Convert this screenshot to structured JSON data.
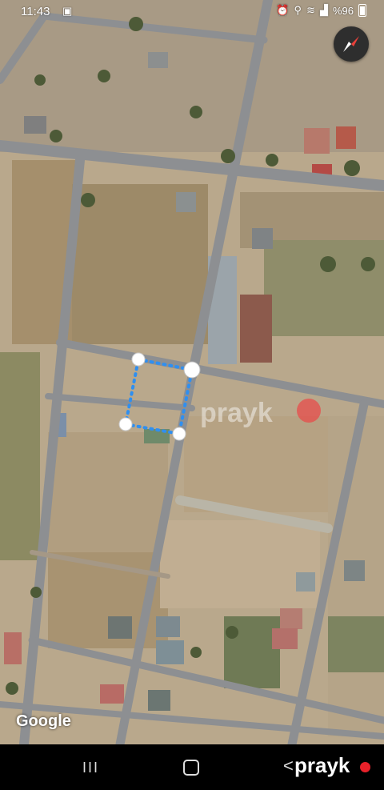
{
  "status_bar": {
    "time": "11:43",
    "battery": "%96",
    "icons": [
      "image-icon",
      "alarm-icon",
      "location-icon",
      "wifi-icon",
      "signal-icon",
      "battery-icon"
    ]
  },
  "map": {
    "provider_logo": "Google",
    "watermark": "prayk",
    "compass_icon": "compass-icon"
  },
  "nav_bar": {
    "recent_glyph": "III",
    "back_glyph": "<",
    "brand": "prayk"
  },
  "colors": {
    "measure_line": "#2f8ff0",
    "brand_dot": "#e8212a",
    "compass_needle": "#e8403a"
  }
}
